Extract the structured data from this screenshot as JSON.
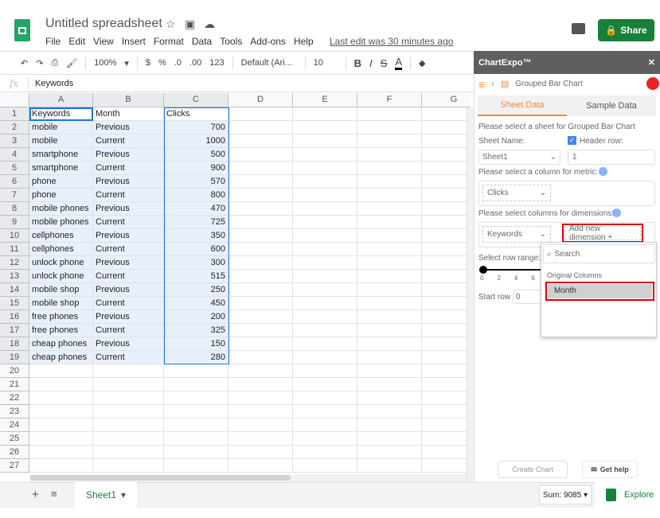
{
  "app": {
    "title": "Untitled spreadsheet",
    "menu": [
      "File",
      "Edit",
      "View",
      "Insert",
      "Format",
      "Data",
      "Tools",
      "Add-ons",
      "Help"
    ],
    "last_edit": "Last edit was 30 minutes ago",
    "share": "Share"
  },
  "toolbar": {
    "zoom": "100%",
    "currency": "$",
    "percent": "%",
    "dec_less": ".0",
    "dec_more": ".00",
    "format": "123",
    "font": "Default (Ari...",
    "size": "10",
    "bold": "B",
    "italic": "I",
    "strike": "S",
    "color": "A"
  },
  "formula": {
    "fx": "fx",
    "value": "Keywords"
  },
  "grid": {
    "columns": [
      "A",
      "B",
      "C",
      "D",
      "E",
      "F",
      "G"
    ],
    "row_count": 27,
    "rows": [
      [
        "Keywords",
        "Month",
        "Clicks"
      ],
      [
        "mobile",
        "Previous",
        "700"
      ],
      [
        "mobile",
        "Current",
        "1000"
      ],
      [
        "smartphone",
        "Previous",
        "500"
      ],
      [
        "smartphone",
        "Current",
        "900"
      ],
      [
        "phone",
        "Previous",
        "570"
      ],
      [
        "phone",
        "Current",
        "800"
      ],
      [
        "mobile phones",
        "Previous",
        "470"
      ],
      [
        "mobile phones",
        "Current",
        "725"
      ],
      [
        "cellphones",
        "Previous",
        "350"
      ],
      [
        "cellphones",
        "Current",
        "600"
      ],
      [
        "unlock phone",
        "Previous",
        "300"
      ],
      [
        "unlock phone",
        "Current",
        "515"
      ],
      [
        "mobile shop",
        "Previous",
        "250"
      ],
      [
        "mobile shop",
        "Current",
        "450"
      ],
      [
        "free phones",
        "Previous",
        "200"
      ],
      [
        "free phones",
        "Current",
        "325"
      ],
      [
        "cheap phones",
        "Previous",
        "150"
      ],
      [
        "cheap phones",
        "Current",
        "280"
      ]
    ]
  },
  "bottom": {
    "sheet": "Sheet1",
    "sum": "Sum: 9085",
    "explore": "Explore"
  },
  "sidebar": {
    "title": "ChartExpo™",
    "close": "✕",
    "chart": "Grouped Bar Chart",
    "tabs": [
      "Sheet Data",
      "Sample Data"
    ],
    "select_sheet": "Please select a sheet for Grouped Bar Chart",
    "sheet_name_label": "Sheet Name:",
    "sheet_name": "Sheet1",
    "header_row_label": "Header row:",
    "header_row": "1",
    "header_checked": true,
    "metric_label": "Please select a column for metric:",
    "metric": "Clicks",
    "dim_label": "Please select columns for dimensions:",
    "dim": "Keywords",
    "add_dim": "Add new dimension +",
    "row_range": "Select row range:",
    "ticks": [
      "0",
      "2",
      "4",
      "6"
    ],
    "start_row": "Start row",
    "start_val": "0",
    "search_placeholder": "Search",
    "orig_cols": "Original Columns",
    "option": "Month",
    "create": "Create Chart",
    "help": "Get help"
  },
  "colors": {
    "accent": "#f08a3c",
    "share": "#188038",
    "selection": "#e8f0fe",
    "highlight": "#dd0000"
  }
}
